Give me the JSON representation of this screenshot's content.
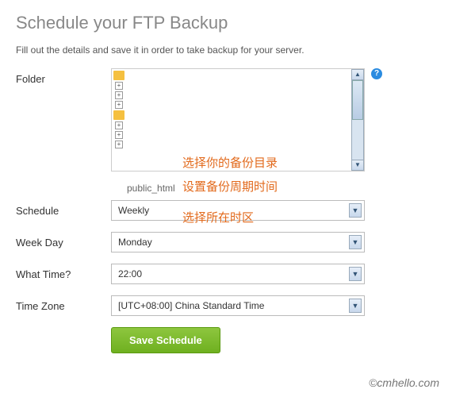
{
  "header": {
    "title": "Schedule your FTP Backup",
    "subtitle": "Fill out the details and save it in order to take backup for your server."
  },
  "labels": {
    "folder": "Folder",
    "schedule": "Schedule",
    "weekday": "Week Day",
    "whattime": "What Time?",
    "timezone": "Time Zone"
  },
  "folder": {
    "selected_path": "public_html"
  },
  "fields": {
    "schedule": "Weekly",
    "weekday": "Monday",
    "time": "22:00",
    "timezone": "[UTC+08:00] China Standard Time"
  },
  "buttons": {
    "save": "Save Schedule"
  },
  "annotations": {
    "a1": "选择你的备份目录",
    "a2": "设置备份周期时间",
    "a3": "选择所在时区"
  },
  "watermark": "©cmhello.com",
  "help_glyph": "?"
}
